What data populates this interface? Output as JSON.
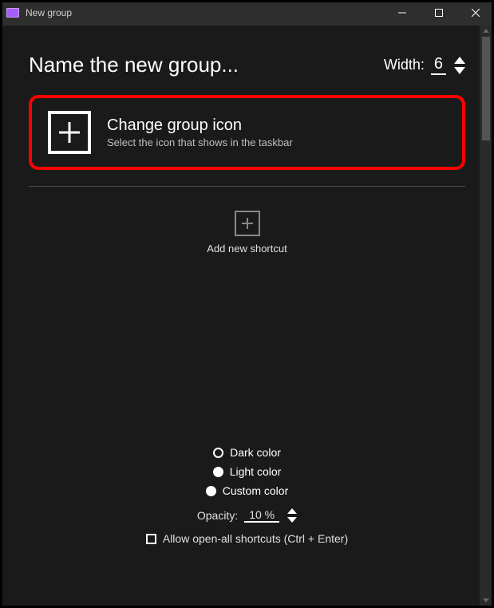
{
  "window": {
    "title": "New group"
  },
  "header": {
    "name_placeholder": "Name the new group...",
    "width_label": "Width:",
    "width_value": "6"
  },
  "icon_card": {
    "title": "Change group icon",
    "subtitle": "Select the icon that shows in the taskbar"
  },
  "add_shortcut": {
    "label": "Add new shortcut"
  },
  "colors": {
    "dark": "Dark color",
    "light": "Light color",
    "custom": "Custom color",
    "selected": "dark"
  },
  "opacity": {
    "label": "Opacity:",
    "value": "10 %"
  },
  "allow_open_all": {
    "label": "Allow open-all shortcuts (Ctrl + Enter)",
    "checked": false
  }
}
